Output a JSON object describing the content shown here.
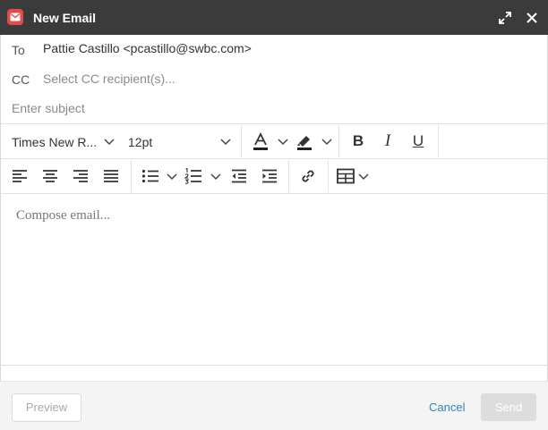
{
  "window": {
    "title": "New Email"
  },
  "to": {
    "label": "To",
    "value": "Pattie Castillo <pcastillo@swbc.com>"
  },
  "cc": {
    "label": "CC",
    "placeholder": "Select CC recipient(s)..."
  },
  "subject": {
    "placeholder": "Enter subject"
  },
  "toolbar": {
    "font_family": "Times New R...",
    "font_size": "12pt",
    "bold": "B",
    "italic": "I",
    "underline": "U",
    "text_color_glyph": "A"
  },
  "compose": {
    "placeholder": "Compose email..."
  },
  "footer": {
    "preview": "Preview",
    "cancel": "Cancel",
    "send": "Send"
  },
  "colors": {
    "titlebar": "#3b3b3b",
    "app_icon": "#e04b4b",
    "link": "#2a86c8",
    "send_disabled": "#dddddd"
  },
  "icons": {
    "app": "envelope-icon",
    "expand": "expand-icon",
    "close": "close-icon"
  }
}
